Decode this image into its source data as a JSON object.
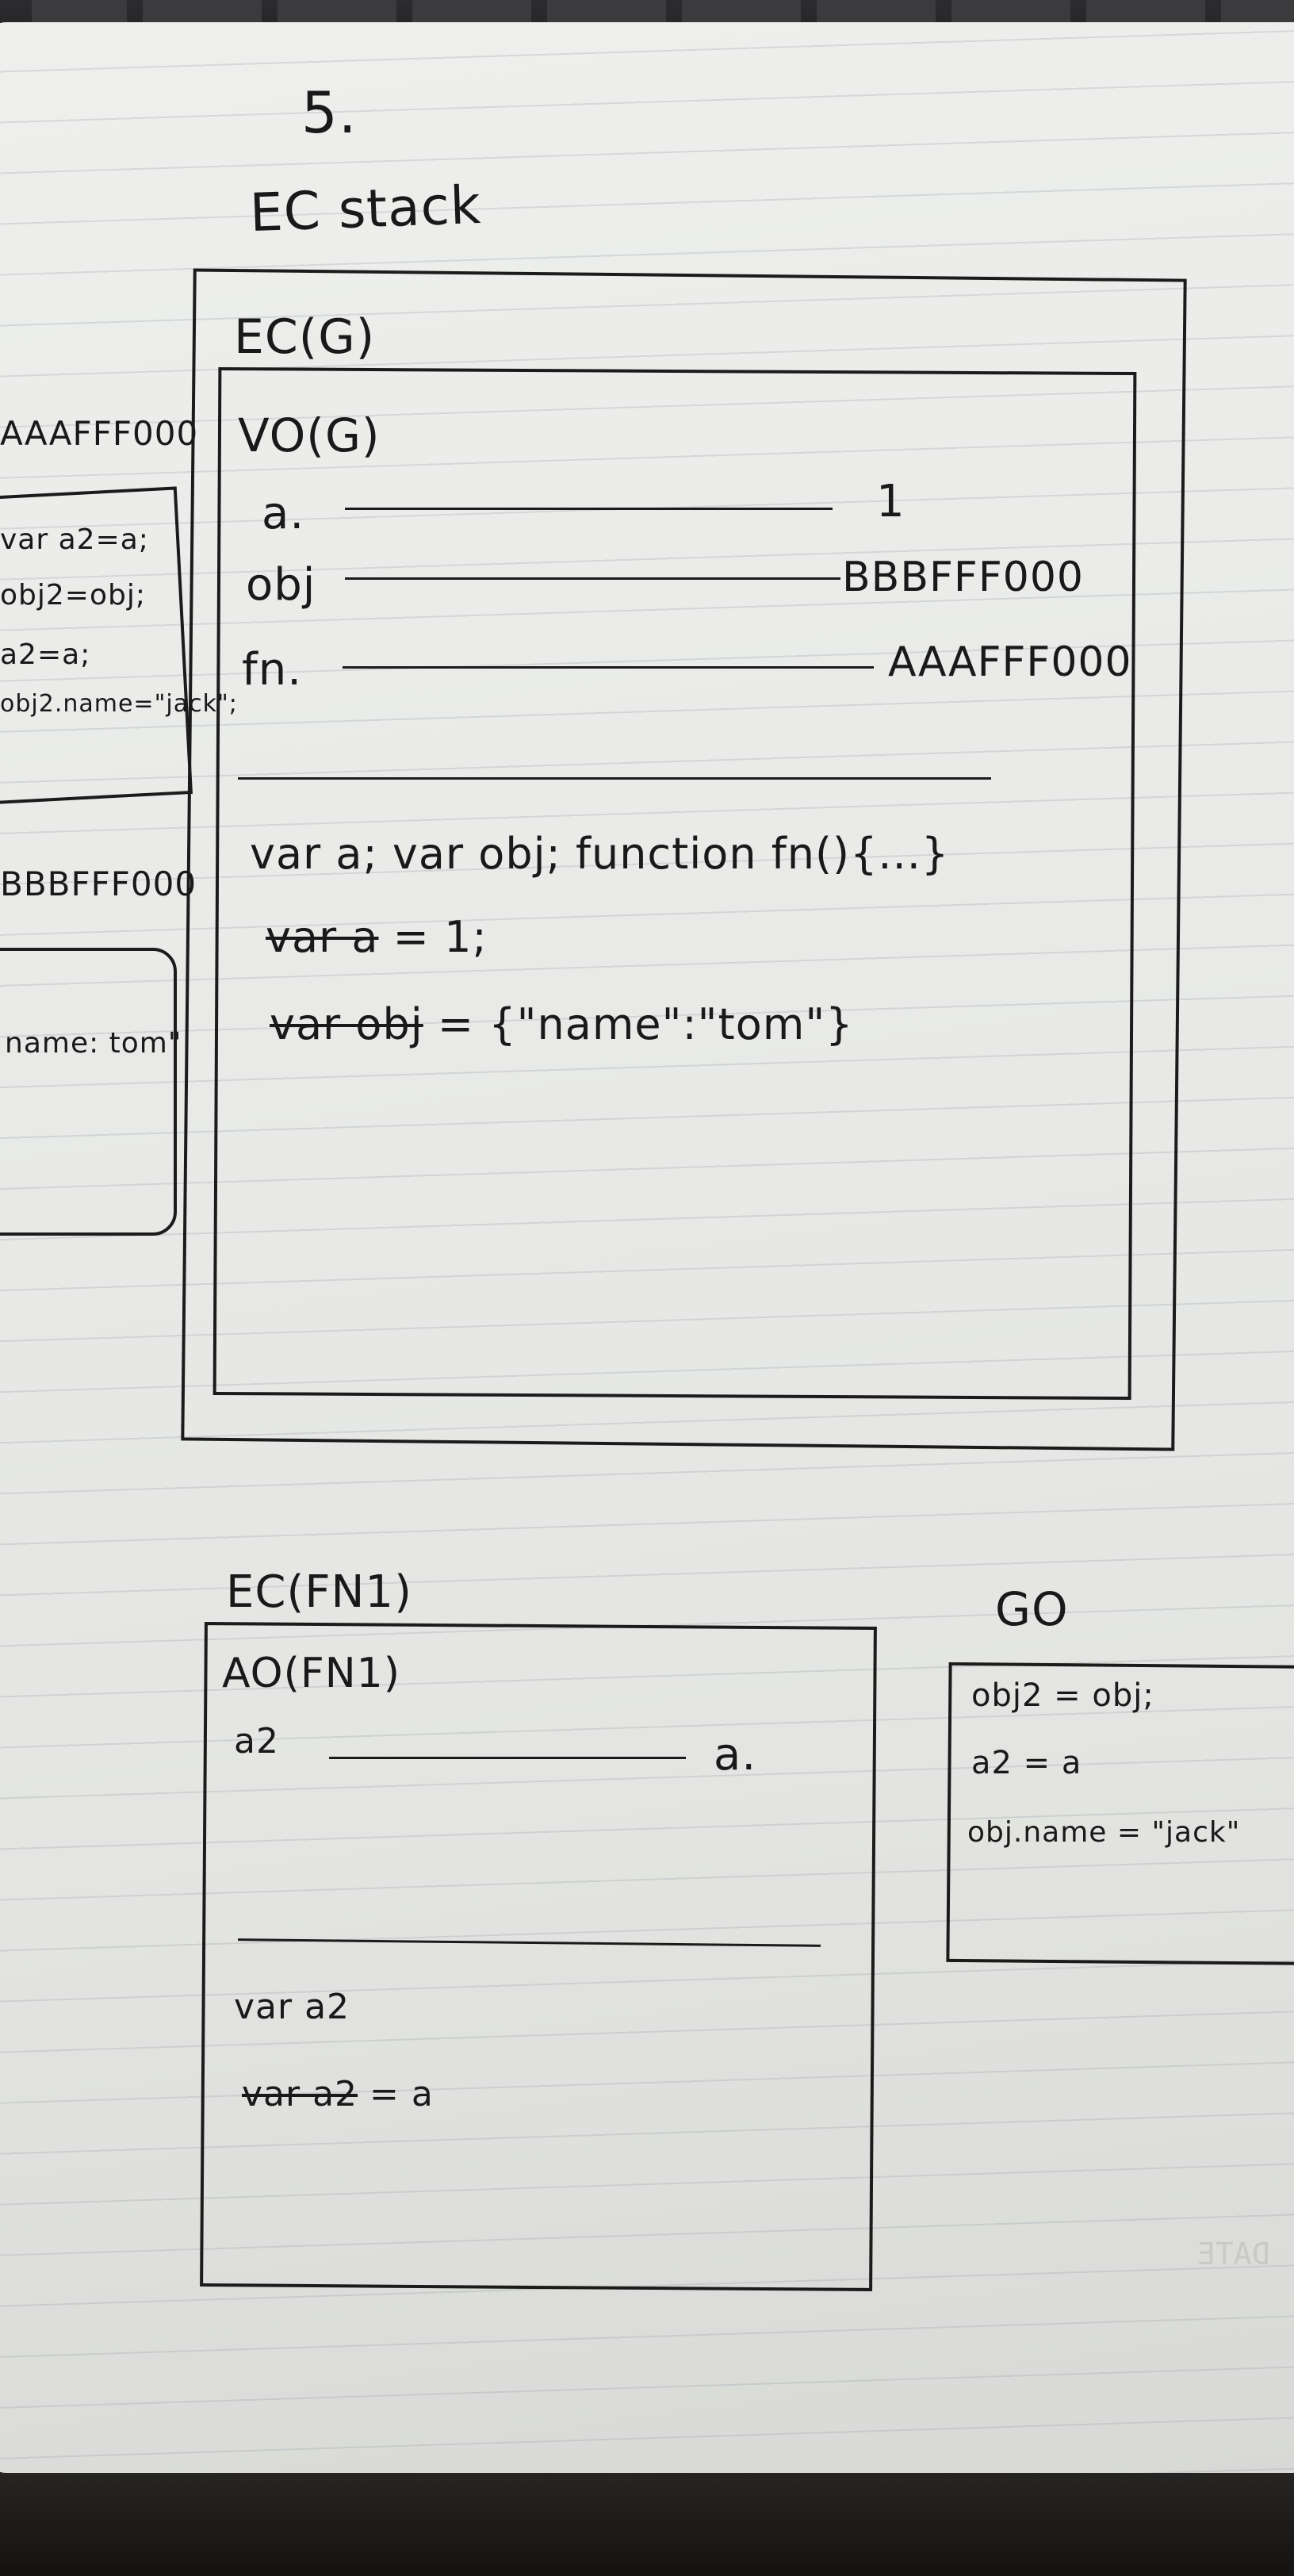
{
  "page_number": "5.",
  "stack_title": "EC stack",
  "ec_global": {
    "title": "EC(G)",
    "vo": {
      "title": "VO(G)",
      "vars": [
        {
          "name": "a.",
          "value": "1"
        },
        {
          "name": "obj",
          "value": "BBBFFF000"
        },
        {
          "name": "fn.",
          "value": "AAAFFF000"
        }
      ]
    },
    "code": [
      {
        "plain": "var a;   var obj;   function fn(){...}"
      },
      {
        "struck": "var a",
        "rest": " = 1;"
      },
      {
        "struck": "var obj",
        "rest": " = {\"name\":\"tom\"}"
      }
    ]
  },
  "left_heap": {
    "fn_address": "AAAFFF000",
    "fn_body": [
      "var a2=a;",
      "obj2=obj;",
      "a2=a;",
      "obj2.name=\"jack\";"
    ],
    "obj_address": "BBBFFF000",
    "obj_body": "name: tom\""
  },
  "ec_fn1": {
    "title": "EC(FN1)",
    "ao": {
      "title": "AO(FN1)",
      "var": "a2",
      "value": "a."
    },
    "code": [
      {
        "plain": "var a2"
      },
      {
        "struck": "var a2",
        "rest": " = a"
      }
    ]
  },
  "go": {
    "title": "GO",
    "lines": [
      "obj2 = obj;",
      "a2 = a",
      "obj.name = \"jack\""
    ]
  },
  "page_bleed": "DATE"
}
